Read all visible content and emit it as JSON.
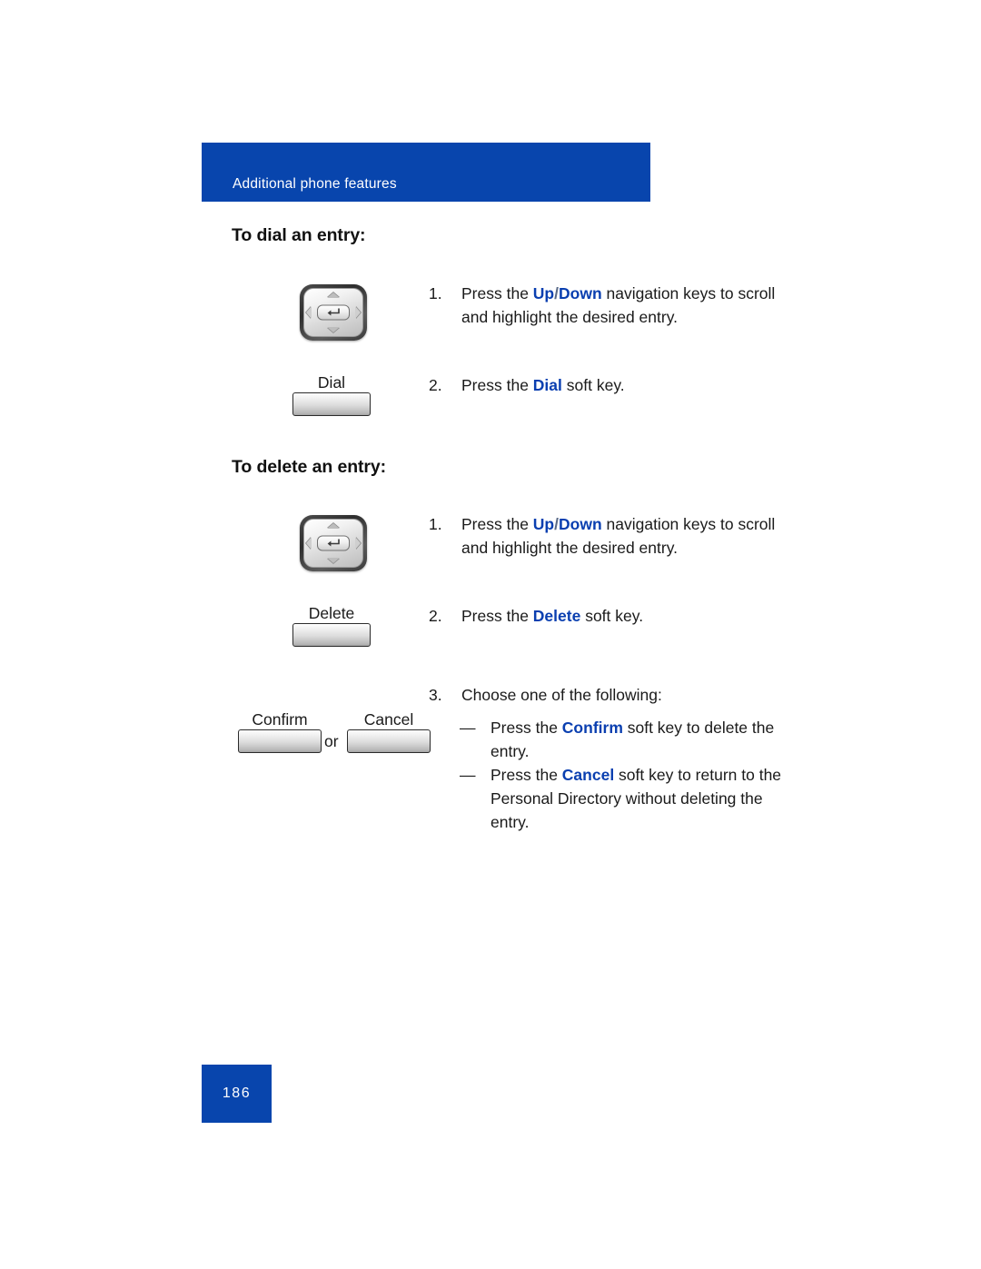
{
  "header": {
    "title": "Additional phone features",
    "bar_color": "#0845ad"
  },
  "sections": [
    {
      "heading": "To dial an entry:",
      "steps": [
        {
          "number": "1.",
          "text_before": "Press the ",
          "keyword": "Up/Down",
          "text_after": " navigation keys to scroll and highlight the desired entry.",
          "icon": "navigation-cluster-key"
        },
        {
          "number": "2.",
          "text_before": "Press the ",
          "keyword": "Dial",
          "text_after": " soft key.",
          "icon": "soft-key",
          "soft_key_label": "Dial"
        }
      ]
    },
    {
      "heading": "To delete an entry:",
      "steps": [
        {
          "number": "1.",
          "text_before": "Press the ",
          "keyword": "Up/Down",
          "text_after": " navigation keys to scroll and highlight the desired entry.",
          "icon": "navigation-cluster-key"
        },
        {
          "number": "2.",
          "text_before": "Press the ",
          "keyword": "Delete",
          "text_after": " soft key.",
          "icon": "soft-key",
          "soft_key_label": "Delete"
        },
        {
          "number": "3.",
          "text_before": "Choose one of the following:",
          "keyword": "",
          "text_after": "",
          "icon": "soft-key-pair",
          "soft_key_label_left": "Confirm",
          "soft_key_label_right": "Cancel",
          "or_label": "or",
          "subitems": [
            {
              "dash": "—",
              "text_before": "Press the ",
              "keyword": "Confirm",
              "text_after": " soft key to delete the entry."
            },
            {
              "dash": "—",
              "text_before": "Press the ",
              "keyword": "Cancel",
              "text_after": " soft key to return to the Personal Directory without deleting the entry."
            }
          ]
        }
      ]
    }
  ],
  "footer": {
    "page_number": "186"
  },
  "colors": {
    "accent_blue": "#0845ad",
    "keyword_blue": "#0a3fb0",
    "text": "#1a1a1a"
  }
}
